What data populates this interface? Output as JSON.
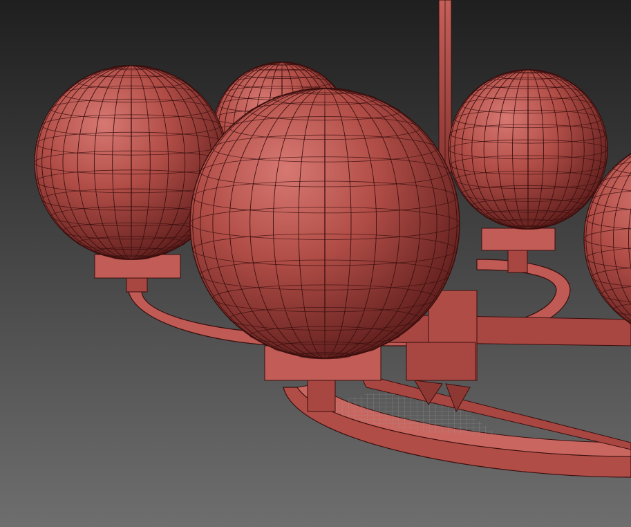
{
  "viewport": {
    "background_top": "#1f1f1f",
    "background_bottom": "#6e6e6e",
    "shading_mode": "wireframe-over-shaded"
  },
  "colors": {
    "model_base": "#b14d47",
    "model_light": "#d77872",
    "model_dark": "#5e1e1c",
    "edge": "#3a0f0e",
    "mesh_grid": "#9a9a9a"
  },
  "model": {
    "type": "chandelier",
    "visible_globes": 5,
    "parts": [
      "rod",
      "outer-ring",
      "inner-ring",
      "hub",
      "globes",
      "cups",
      "stems"
    ]
  }
}
